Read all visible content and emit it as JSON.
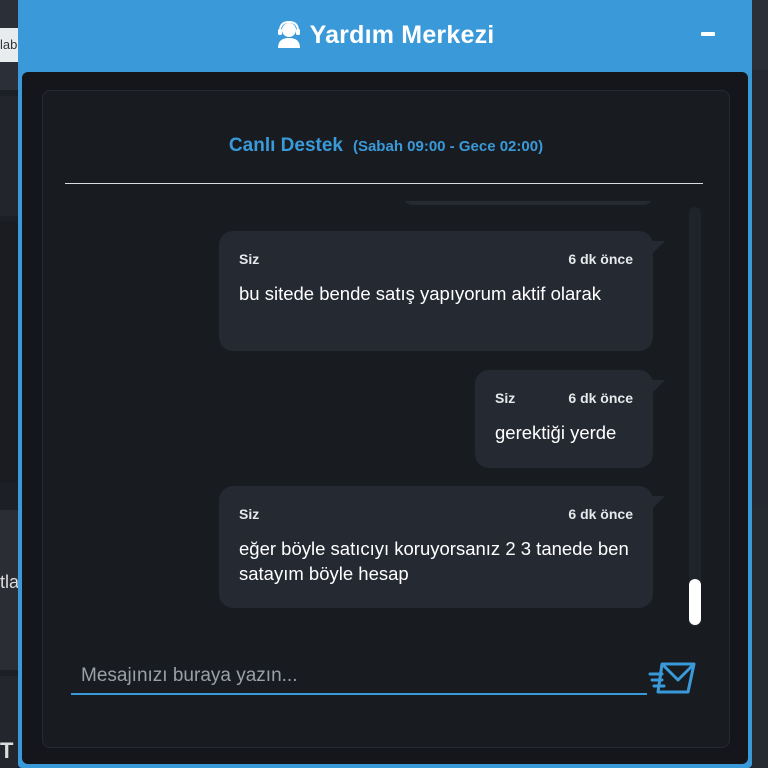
{
  "background": {
    "tab_fragment": "lab",
    "text_fragment": "tla",
    "letter_fragment": "T"
  },
  "widget": {
    "title": "Yardım Merkezi",
    "minimize_icon": "minus-icon",
    "agent_icon": "support-agent-icon",
    "accent_color": "#3a9ad9"
  },
  "support": {
    "name": "Canlı Destek",
    "hours": "(Sabah 09:00 - Gece 02:00)"
  },
  "messages": [
    {
      "sender": "Siz",
      "time": "6 dk önce",
      "text": "bu sitede bende satış yapıyorum aktif olarak"
    },
    {
      "sender": "Siz",
      "time": "6 dk önce",
      "text": "gerektiği yerde"
    },
    {
      "sender": "Siz",
      "time": "6 dk önce",
      "text": "eğer böyle satıcıyı koruyorsanız 2 3 tanede ben satayım böyle hesap"
    }
  ],
  "input": {
    "placeholder": "Mesajınızı buraya yazın...",
    "value": ""
  },
  "send_icon": "send-mail-icon"
}
